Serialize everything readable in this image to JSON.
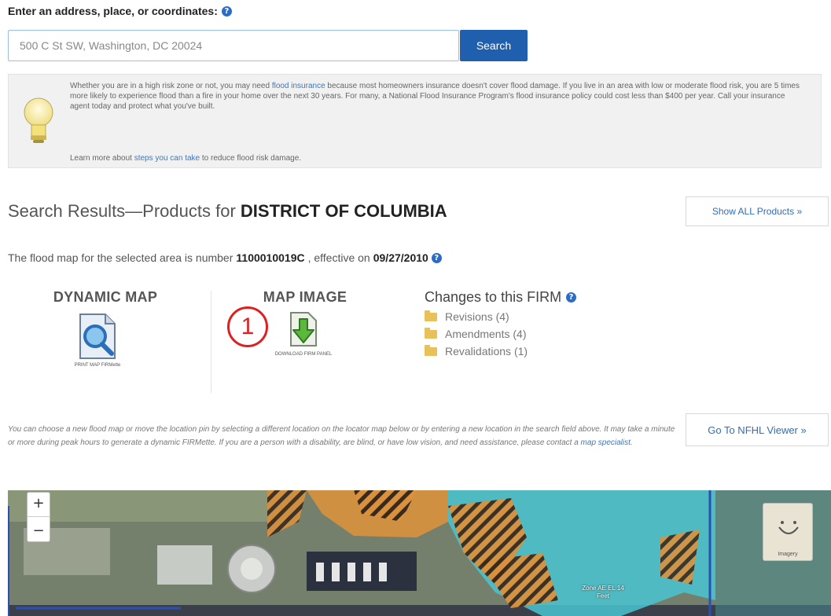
{
  "search": {
    "label": "Enter an address, place, or coordinates:",
    "value": "500 C St SW, Washington, DC 20024",
    "button_label": "Search"
  },
  "info": {
    "paragraph_before_link": "Whether you are in a high risk zone or not, you may need ",
    "link_text": "flood insurance",
    "paragraph_after_link": " because most homeowners insurance doesn't cover flood damage. If you live in an area with low or moderate flood risk, you are 5 times more likely to experience flood than a fire in your home over the next 30 years. For many, a National Flood Insurance Program's flood insurance policy could cost less than $400 per year. Call your insurance agent today and protect what you've built.",
    "learn_before": "Learn more about ",
    "learn_link": "steps you can take",
    "learn_after": " to reduce flood risk damage."
  },
  "results": {
    "title_prefix": "Search Results—Products for ",
    "title_place": "DISTRICT OF COLUMBIA",
    "show_all_label": "Show ALL Products »"
  },
  "flood_map": {
    "text_before": "The flood map for the selected area is number ",
    "number": "1100010019C",
    "text_mid": ", effective on ",
    "date": "09/27/2010"
  },
  "products": {
    "dynamic_title": "DYNAMIC MAP",
    "dynamic_caption": "PRINT MAP FIRMette",
    "image_title": "MAP IMAGE",
    "image_caption": "DOWNLOAD FIRM PANEL"
  },
  "callout": {
    "number": "1"
  },
  "changes": {
    "title": "Changes to this FIRM",
    "items": [
      {
        "label": "Revisions (4)"
      },
      {
        "label": "Amendments (4)"
      },
      {
        "label": "Revalidations (1)"
      }
    ]
  },
  "nfhl": {
    "paragraph_before_link": "You can choose a new flood map or move the location pin by selecting a different location on the locator map below or by entering a new location in the search field above. It may take a minute or more during peak hours to generate a dynamic FIRMette. If you are a person with a disability, are blind, or have low vision, and need assistance, please contact a ",
    "link_text": "map specialist",
    "paragraph_after_link": ".",
    "button_label": "Go To NFHL Viewer »"
  },
  "map": {
    "zoom_in": "+",
    "zoom_out": "−",
    "compass_label": "Imagery",
    "zone_label": "Zone AE EL 14 Feet"
  },
  "colors": {
    "primary_blue": "#1f5fae",
    "link_blue": "#3a78c2",
    "callout_red": "#e02020",
    "flood_zone_cyan": "#49c4d0",
    "hatch_orange": "#d9913e"
  }
}
